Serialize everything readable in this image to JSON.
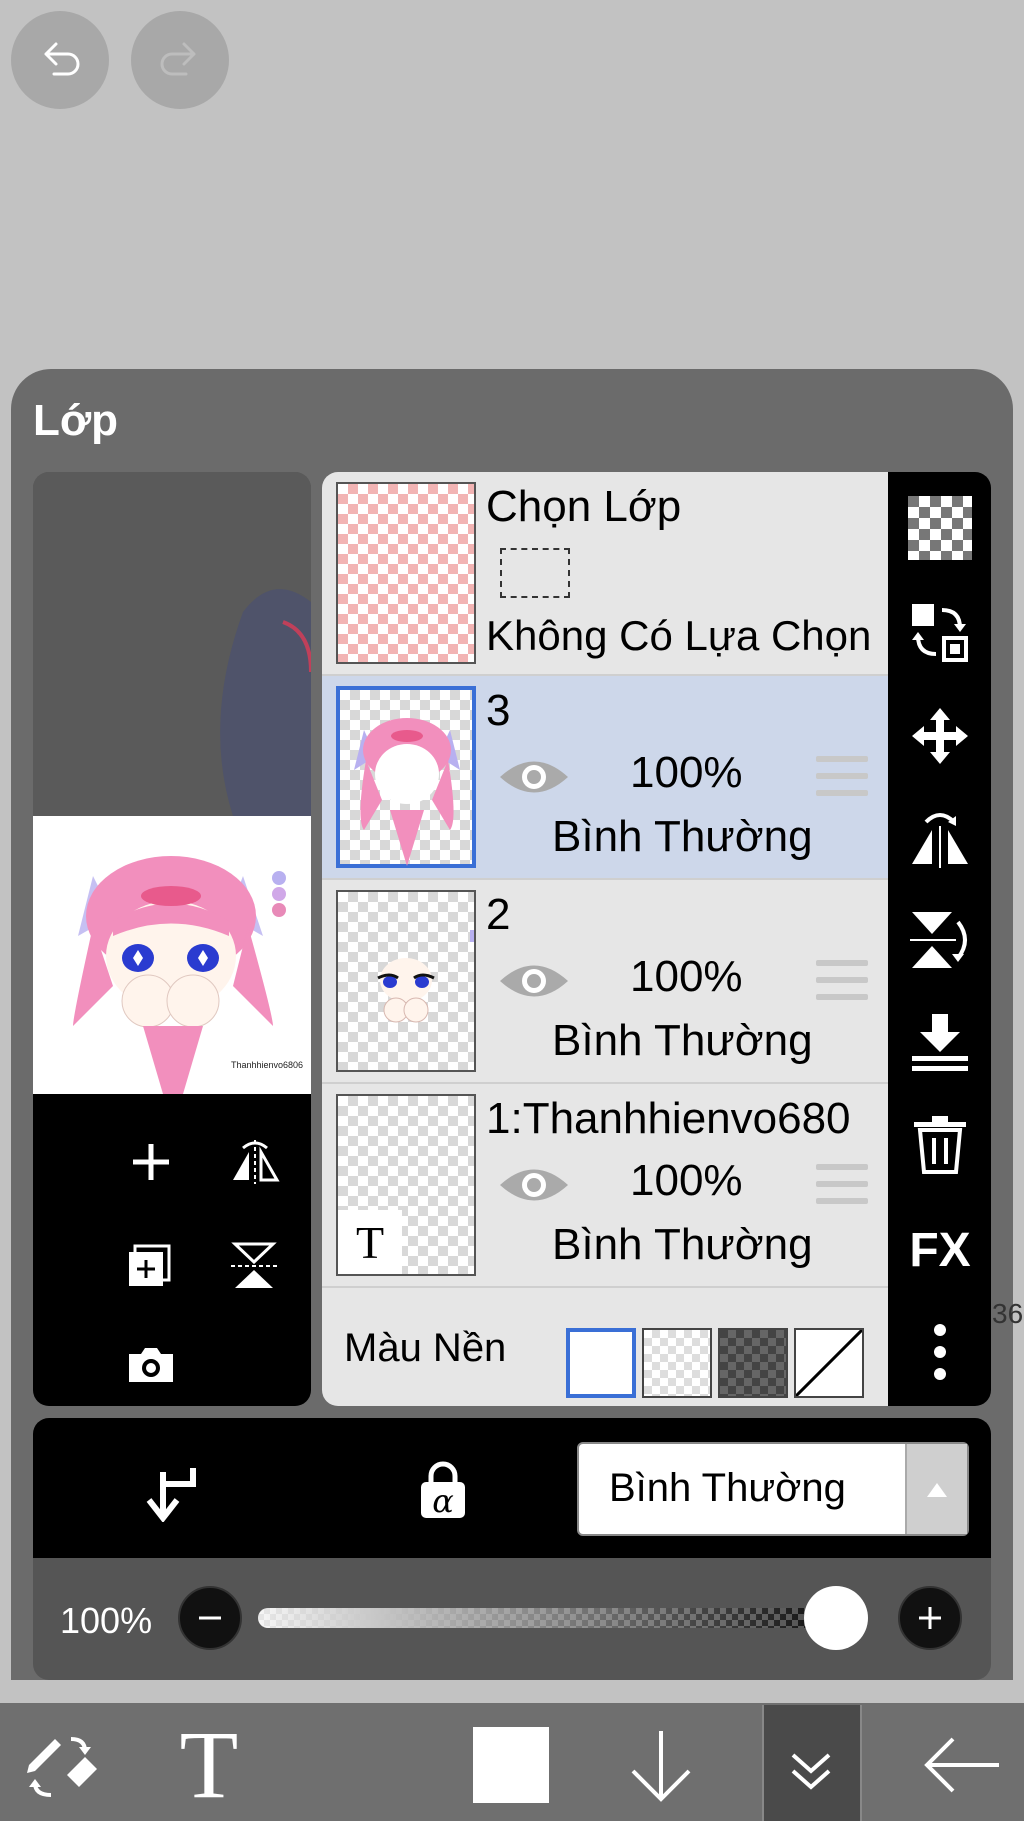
{
  "panel": {
    "title": "Lớp"
  },
  "history": {
    "undo_icon": "undo-icon",
    "redo_icon": "redo-icon"
  },
  "preview": {
    "tools": [
      "add-layer-icon",
      "flip-horizontal-icon",
      "add-copy-layer-icon",
      "flip-vertical-icon",
      "camera-icon"
    ],
    "watermark": "Thanhhienvo6806"
  },
  "layers": {
    "selection_layer": {
      "title": "Chọn Lớp",
      "status": "Không Có Lựa Chọn"
    },
    "items": [
      {
        "name": "3",
        "opacity": "100%",
        "blend": "Bình Thường",
        "selected": true
      },
      {
        "name": "2",
        "opacity": "100%",
        "blend": "Bình Thường",
        "selected": false
      },
      {
        "name": "1:Thanhhienvo680",
        "opacity": "100%",
        "blend": "Bình Thường",
        "selected": false,
        "thumb_text": "T"
      }
    ],
    "background": {
      "label": "Màu Nền"
    }
  },
  "side_tools": {
    "icons": [
      "transparency-icon",
      "swap-layer-icon",
      "move-icon",
      "flip-rotate-icon",
      "flip-vertical-rotate-icon",
      "merge-down-icon",
      "trash-icon"
    ],
    "fx_label": "FX",
    "more_icon": "more-vertical-icon"
  },
  "side_number": "36",
  "actions": {
    "clip_icon": "clipping-arrow-icon",
    "alpha_lock_icon": "alpha-lock-icon",
    "blend_mode": "Bình Thường"
  },
  "opacity": {
    "label": "100%",
    "value": 1.0
  },
  "bottom_toolbar": {
    "icons": [
      "pen-eraser-swap-icon",
      "text-tool-icon",
      "color-swatch-icon",
      "down-arrow-icon",
      "collapse-icon",
      "back-arrow-icon"
    ],
    "text_glyph": "T"
  },
  "colors": {
    "accent": "#3a6fd6",
    "selected_row": "#cdd7ea"
  }
}
